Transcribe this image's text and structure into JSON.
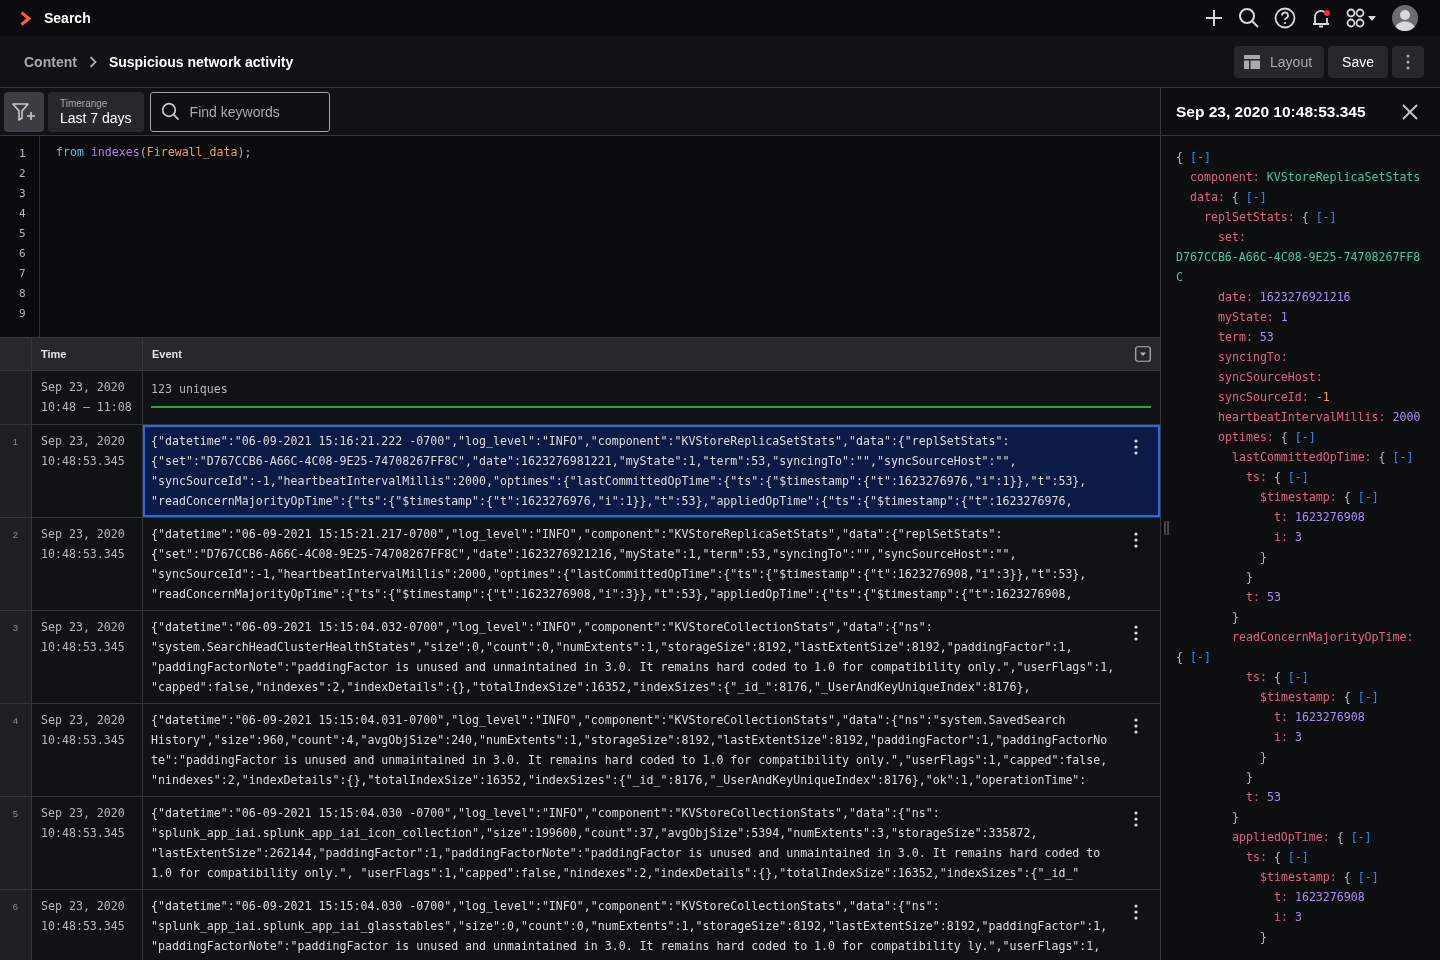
{
  "app": {
    "title": "Search"
  },
  "notifications": {
    "unread": true
  },
  "breadcrumb": {
    "parent": "Content",
    "current": "Suspicious network activity"
  },
  "actions": {
    "layout": "Layout",
    "save": "Save"
  },
  "toolbar": {
    "timerange": {
      "label": "Timerange",
      "value": "Last 7 days"
    },
    "search": {
      "placeholder": "Find keywords"
    }
  },
  "editor": {
    "line_numbers": [
      "1",
      "2",
      "3",
      "4",
      "5",
      "6",
      "7",
      "8",
      "9"
    ],
    "lines": [
      [
        {
          "text": "from",
          "kind": "keyword"
        },
        {
          "text": "indexes",
          "kind": "function",
          "space": true
        },
        {
          "text": "(",
          "kind": "punct"
        },
        {
          "text": "Firewall_data",
          "kind": "string"
        },
        {
          "text": ");",
          "kind": "punct"
        }
      ]
    ]
  },
  "table": {
    "columns": [
      "Time",
      "Event"
    ],
    "summary": {
      "date": "Sep 23, 2020",
      "range": "10:48 – 11:08",
      "text": "123 uniques"
    },
    "rows": [
      {
        "number": "1",
        "date": "Sep 23, 2020",
        "time": "10:48:53.345",
        "selected": true,
        "event": [
          "{\"datetime\":\"06-09-2021 15:16:21.222 -0700\",\"log_level\":\"INFO\",\"component\":\"KVStoreReplicaSetStats\",\"data\":{\"replSetStats\":",
          "{\"set\":\"D767CCB6-A66C-4C08-9E25-74708267FF8C\",\"date\":1623276981221,\"myState\":1,\"term\":53,\"syncingTo\":\"\",\"syncSourceHost\":\"\",",
          "\"syncSourceId\":-1,\"heartbeatIntervalMillis\":2000,\"optimes\":{\"lastCommittedOpTime\":{\"ts\":{\"$timestamp\":{\"t\":1623276976,\"i\":1}},\"t\":53},",
          "\"readConcernMajorityOpTime\":{\"ts\":{\"$timestamp\":{\"t\":1623276976,\"i\":1}},\"t\":53},\"appliedOpTime\":{\"ts\":{\"$timestamp\":{\"t\":1623276976,"
        ]
      },
      {
        "number": "2",
        "date": "Sep 23, 2020",
        "time": "10:48:53.345",
        "selected": false,
        "event": [
          "{\"datetime\":\"06-09-2021 15:15:21.217-0700\",\"log_level\":\"INFO\",\"component\":\"KVStoreReplicaSetStats\",\"data\":{\"replSetStats\":",
          "{\"set\":\"D767CCB6-A66C-4C08-9E25-74708267FF8C\",\"date\":1623276921216,\"myState\":1,\"term\":53,\"syncingTo\":\"\",\"syncSourceHost\":\"\",",
          "\"syncSourceId\":-1,\"heartbeatIntervalMillis\":2000,\"optimes\":{\"lastCommittedOpTime\":{\"ts\":{\"$timestamp\":{\"t\":1623276908,\"i\":3}},\"t\":53},",
          "\"readConcernMajorityOpTime\":{\"ts\":{\"$timestamp\":{\"t\":1623276908,\"i\":3}},\"t\":53},\"appliedOpTime\":{\"ts\":{\"$timestamp\":{\"t\":1623276908,"
        ]
      },
      {
        "number": "3",
        "date": "Sep 23, 2020",
        "time": "10:48:53.345",
        "selected": false,
        "event": [
          "{\"datetime\":\"06-09-2021 15:15:04.032-0700\",\"log_level\":\"INFO\",\"component\":\"KVStoreCollectionStats\",\"data\":{\"ns\":",
          "\"system.SearchHeadClusterHealthStates\",\"size\":0,\"count\":0,\"numExtents\":1,\"storageSize\":8192,\"lastExtentSize\":8192,\"paddingFactor\":1,",
          "\"paddingFactorNote\":\"paddingFactor is unused and unmaintained in 3.0. It remains hard coded to 1.0 for compatibility only.\",\"userFlags\":1,",
          "\"capped\":false,\"nindexes\":2,\"indexDetails\":{},\"totalIndexSize\":16352,\"indexSizes\":{\"_id_\":8176,\"_UserAndKeyUniqueIndex\":8176},"
        ]
      },
      {
        "number": "4",
        "date": "Sep 23, 2020",
        "time": "10:48:53.345",
        "selected": false,
        "event": [
          "{\"datetime\":\"06-09-2021 15:15:04.031-0700\",\"log_level\":\"INFO\",\"component\":\"KVStoreCollectionStats\",\"data\":{\"ns\":\"system.SavedSearch",
          "History\",\"size\":960,\"count\":4,\"avgObjSize\":240,\"numExtents\":1,\"storageSize\":8192,\"lastExtentSize\":8192,\"paddingFactor\":1,\"paddingFactorNo",
          "te\":\"paddingFactor is unused and unmaintained in 3.0. It remains hard coded to 1.0 for compatibility only.\",\"userFlags\":1,\"capped\":false,",
          "\"nindexes\":2,\"indexDetails\":{},\"totalIndexSize\":16352,\"indexSizes\":{\"_id_\":8176,\"_UserAndKeyUniqueIndex\":8176},\"ok\":1,\"operationTime\":"
        ]
      },
      {
        "number": "5",
        "date": "Sep 23, 2020",
        "time": "10:48:53.345",
        "selected": false,
        "event": [
          "{\"datetime\":\"06-09-2021 15:15:04.030 -0700\",\"log_level\":\"INFO\",\"component\":\"KVStoreCollectionStats\",\"data\":{\"ns\":",
          "\"splunk_app_iai.splunk_app_iai_icon_collection\",\"size\":199600,\"count\":37,\"avgObjSize\":5394,\"numExtents\":3,\"storageSize\":335872,",
          "\"lastExtentSize\":262144,\"paddingFactor\":1,\"paddingFactorNote\":\"paddingFactor is unused and unmaintained in 3.0. It remains hard coded to",
          "1.0 for compatibility only.\", \"userFlags\":1,\"capped\":false,\"nindexes\":2,\"indexDetails\":{},\"totalIndexSize\":16352,\"indexSizes\":{\"_id_\""
        ]
      },
      {
        "number": "6",
        "date": "Sep 23, 2020",
        "time": "10:48:53.345",
        "selected": false,
        "event": [
          "{\"datetime\":\"06-09-2021 15:15:04.030 -0700\",\"log_level\":\"INFO\",\"component\":\"KVStoreCollectionStats\",\"data\":{\"ns\":",
          "\"splunk_app_iai.splunk_app_iai_glasstables\",\"size\":0,\"count\":0,\"numExtents\":1,\"storageSize\":8192,\"lastExtentSize\":8192,\"paddingFactor\":1,",
          "\"paddingFactorNote\":\"paddingFactor is unused and unmaintained in 3.0. It remains hard coded to 1.0 for compatibility ly.\",\"userFlags\":1,"
        ]
      }
    ]
  },
  "detail": {
    "title": "Sep 23, 2020 10:48:53.345",
    "tree": {
      "open": "{",
      "toggle": "[-]",
      "children": [
        {
          "key": "component:",
          "value": "KVStoreReplicaSetStats",
          "kind": "string"
        },
        {
          "key": "data:",
          "open": "{",
          "toggle": "[-]",
          "children": [
            {
              "key": "replSetStats:",
              "open": "{",
              "toggle": "[-]",
              "children": [
                {
                  "key": "set:",
                  "value": "D767CCB6-A66C-4C08-9E25-74708267FF8C",
                  "kind": "string",
                  "wrap": true
                },
                {
                  "key": "date:",
                  "value": "1623276921216",
                  "kind": "number"
                },
                {
                  "key": "myState:",
                  "value": "1",
                  "kind": "number"
                },
                {
                  "key": "term:",
                  "value": "53",
                  "kind": "number"
                },
                {
                  "key": "syncingTo:"
                },
                {
                  "key": "syncSourceHost:"
                },
                {
                  "key": "syncSourceId:",
                  "value": "-1",
                  "kind": "negative"
                },
                {
                  "key": "heartbeatIntervalMillis:",
                  "value": "2000",
                  "kind": "number"
                },
                {
                  "key": "optimes:",
                  "open": "{",
                  "toggle": "[-]",
                  "children": [
                    {
                      "key": "lastCommittedOpTime:",
                      "open": "{",
                      "toggle": "[-]",
                      "children": [
                        {
                          "key": "ts:",
                          "open": "{",
                          "toggle": "[-]",
                          "children": [
                            {
                              "key": "$timestamp:",
                              "open": "{",
                              "toggle": "[-]",
                              "children": [
                                {
                                  "key": "t:",
                                  "value": "1623276908",
                                  "kind": "number"
                                },
                                {
                                  "key": "i:",
                                  "value": "3",
                                  "kind": "number"
                                }
                              ],
                              "close": "}"
                            }
                          ],
                          "close": "}"
                        },
                        {
                          "key": "t:",
                          "value": "53",
                          "kind": "number"
                        }
                      ],
                      "close": "}"
                    },
                    {
                      "key": "readConcernMajorityOpTime:",
                      "wrap": true,
                      "open": "{",
                      "toggle": "[-]",
                      "children": [
                        {
                          "key": "ts:",
                          "open": "{",
                          "toggle": "[-]",
                          "children": [
                            {
                              "key": "$timestamp:",
                              "open": "{",
                              "toggle": "[-]",
                              "children": [
                                {
                                  "key": "t:",
                                  "value": "1623276908",
                                  "kind": "number"
                                },
                                {
                                  "key": "i:",
                                  "value": "3",
                                  "kind": "number"
                                }
                              ],
                              "close": "}"
                            }
                          ],
                          "close": "}"
                        },
                        {
                          "key": "t:",
                          "value": "53",
                          "kind": "number"
                        }
                      ],
                      "close": "}"
                    },
                    {
                      "key": "appliedOpTime:",
                      "open": "{",
                      "toggle": "[-]",
                      "children": [
                        {
                          "key": "ts:",
                          "open": "{",
                          "toggle": "[-]",
                          "children": [
                            {
                              "key": "$timestamp:",
                              "open": "{",
                              "toggle": "[-]",
                              "children": [
                                {
                                  "key": "t:",
                                  "value": "1623276908",
                                  "kind": "number"
                                },
                                {
                                  "key": "i:",
                                  "value": "3",
                                  "kind": "number"
                                }
                              ],
                              "close": "}"
                            }
                          ]
                        }
                      ]
                    }
                  ]
                }
              ]
            }
          ]
        }
      ]
    }
  }
}
